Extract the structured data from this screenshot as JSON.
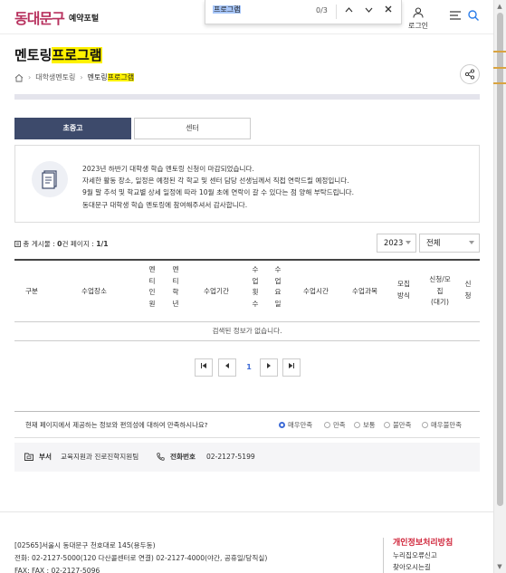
{
  "header": {
    "logo": "동대문구",
    "portal": "예약포털",
    "login_label": "로그인"
  },
  "findbar": {
    "query": "프로그램",
    "count": "0/3"
  },
  "page": {
    "title_prefix": "멘토링",
    "title_highlight": "프로그램",
    "breadcrumb": [
      "대학생멘토링",
      "멘토링"
    ],
    "breadcrumb_highlight": "프로그램"
  },
  "tabs": [
    {
      "label": "초중고",
      "active": true
    },
    {
      "label": "센터",
      "active": false
    }
  ],
  "notice": {
    "lines": [
      "2023년 하반기 대학생 학습 멘토링 신청이 마감되었습니다.",
      "자세한 활동 장소, 일정은 예정된 각 학교 및 센터 담당 선생님께서 직접 연락드릴 예정입니다.",
      "9월 말 추석 및 학교별 상세 일정에 따라 10월 초에 연락이 갈 수 있다는 점 양해 부탁드립니다.",
      "동대문구 대학생 학습 멘토링에 참여해주셔서 감사합니다."
    ]
  },
  "list": {
    "total_label": "총 게시물 : ",
    "total_value": "0",
    "total_unit": "건",
    "page_label": " 페이지 : ",
    "page_value": "1/1",
    "year_select": "2023",
    "filter_select": "전체"
  },
  "table": {
    "headers": [
      "구분",
      "수업장소",
      "멘\n티\n인\n원",
      "멘\n티\n학\n년",
      "수업기간",
      "수\n업\n횟\n수",
      "수\n업\n요\n일",
      "수업시간",
      "수업과목",
      "모집\n방식",
      "신청/모\n집\n(대기)",
      "신\n청"
    ],
    "empty_message": "검색된 정보가 없습니다."
  },
  "pagination": {
    "first": "⏮",
    "prev": "◀",
    "current": "1",
    "next": "▶",
    "last": "⏭"
  },
  "survey": {
    "question": "현재 페이지에서 제공하는 정보와 편의성에 대하여 만족하시나요?",
    "options": [
      "매우만족",
      "만족",
      "보통",
      "불만족",
      "매우불만족"
    ],
    "selected": "매우만족"
  },
  "dept": {
    "dept_label": "부서",
    "dept_value": "교육지원과 진로진학지원팀",
    "phone_label": "전화번호",
    "phone_value": "02-2127-5199"
  },
  "footer": {
    "address_lines": [
      "[02565]서울시 동대문구 천호대로 145(용두동)",
      "전화: 02-2127-5000(120 다산콜센터로 연결) 02-2127-4000(야간, 공휴일/당직실)",
      "FAX: FAX : 02-2127-5096"
    ],
    "privacy": "개인정보처리방침",
    "links": [
      "누리집오류신고",
      "찾아오시는길"
    ]
  },
  "colors": {
    "brand": "#b8325f",
    "tab_active": "#3d4a6b",
    "highlight": "#fff200",
    "link_blue": "#3d6bd6",
    "privacy_red": "#d0263b"
  }
}
